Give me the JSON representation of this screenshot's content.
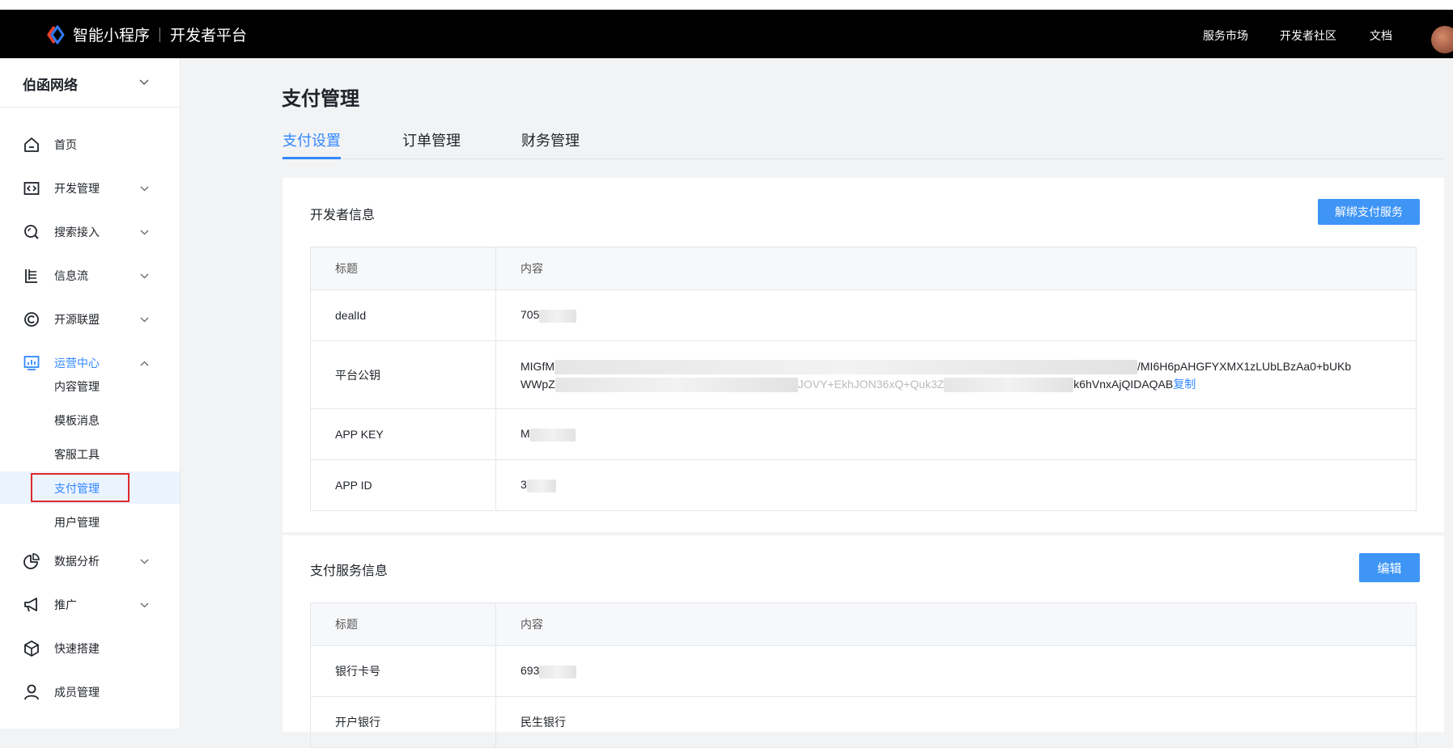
{
  "header": {
    "brand_name": "智能小程序",
    "brand_sub": "开发者平台",
    "nav": [
      "服务市场",
      "开发者社区",
      "文档"
    ]
  },
  "sidebar": {
    "org_name": "伯函网络",
    "items": [
      {
        "label": "首页",
        "icon": "home-icon"
      },
      {
        "label": "开发管理",
        "icon": "code-icon"
      },
      {
        "label": "搜索接入",
        "icon": "search-icon"
      },
      {
        "label": "信息流",
        "icon": "feed-icon"
      },
      {
        "label": "开源联盟",
        "icon": "copyright-icon"
      },
      {
        "label": "运营中心",
        "icon": "monitor-chart-icon",
        "expanded": true
      },
      {
        "label": "数据分析",
        "icon": "pie-chart-icon"
      },
      {
        "label": "推广",
        "icon": "megaphone-icon"
      },
      {
        "label": "快速搭建",
        "icon": "cube-icon"
      },
      {
        "label": "成员管理",
        "icon": "user-icon"
      }
    ],
    "sub_items": [
      "内容管理",
      "模板消息",
      "客服工具",
      "支付管理",
      "用户管理"
    ],
    "selected_sub": "支付管理"
  },
  "main": {
    "title": "支付管理",
    "tabs": [
      "支付设置",
      "订单管理",
      "财务管理"
    ],
    "active_tab": "支付设置"
  },
  "developer_info": {
    "title": "开发者信息",
    "unbind_button": "解绑支付服务",
    "col_title": "标题",
    "col_content": "内容",
    "rows": [
      {
        "label": "dealId",
        "value": "705"
      },
      {
        "label": "平台公钥",
        "value_start": "MIGfM",
        "value_mid": "/MI6H6pAHGFYXMX1zLUbLBzAa0+bUKb",
        "value_line2_start": "WWpZ",
        "value_line2_mid1": "JOVY+EkhJON36xQ+Quk3Z",
        "value_line2_end": "k6hVnxAjQIDAQAB",
        "copy_label": "复制"
      },
      {
        "label": "APP KEY",
        "value": "M"
      },
      {
        "label": "APP ID",
        "value": "3"
      }
    ]
  },
  "payment_info": {
    "title": "支付服务信息",
    "edit_button": "编辑",
    "col_title": "标题",
    "col_content": "内容",
    "rows": [
      {
        "label": "银行卡号",
        "value": "693"
      },
      {
        "label": "开户银行",
        "value": "民生银行"
      }
    ]
  }
}
